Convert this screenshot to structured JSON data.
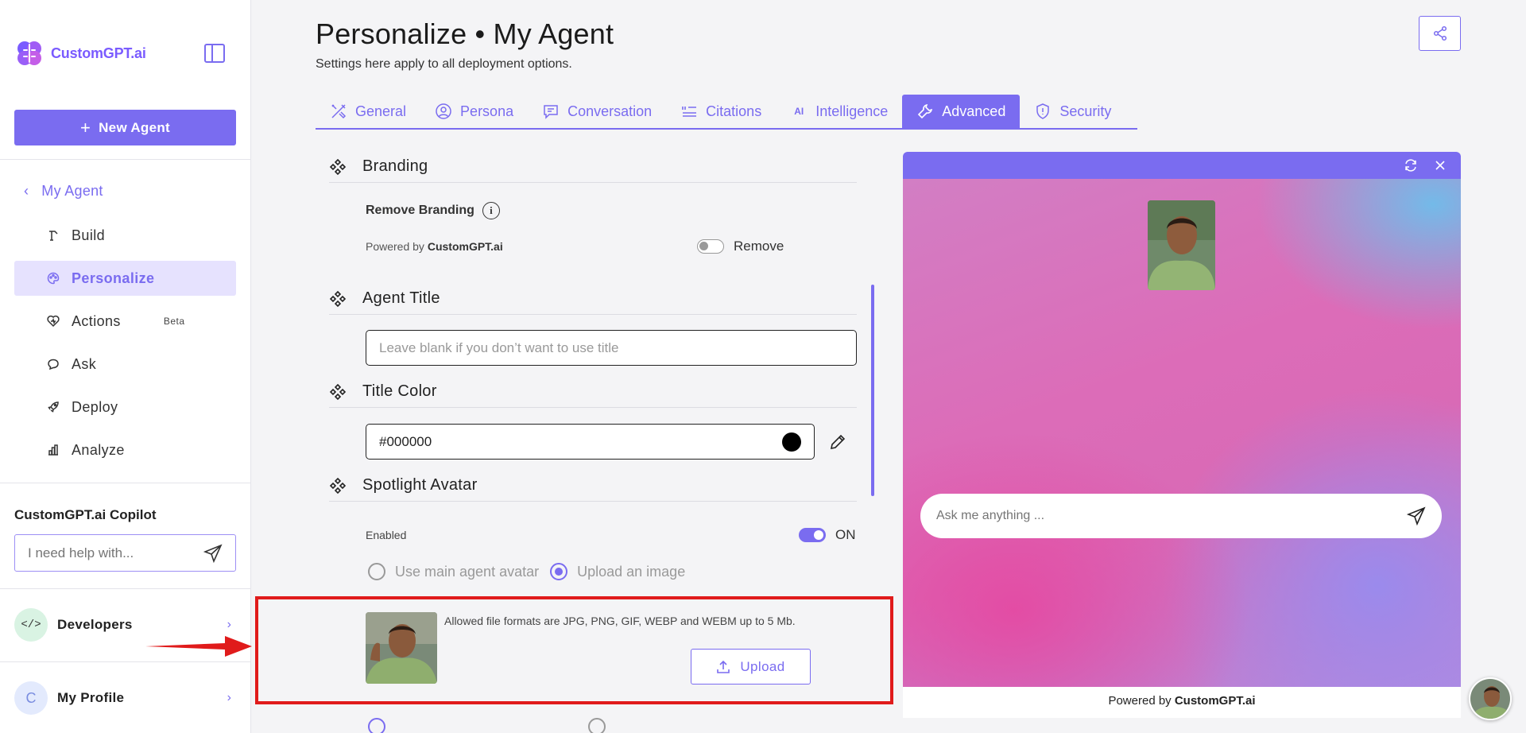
{
  "brand": {
    "name": "CustomGPT.ai",
    "accent": "#7a6cf0"
  },
  "sidebar": {
    "new_agent_label": "New Agent",
    "back_label": "My Agent",
    "items": [
      {
        "label": "Build",
        "icon": "build-icon"
      },
      {
        "label": "Personalize",
        "icon": "palette-icon",
        "active": true
      },
      {
        "label": "Actions",
        "icon": "actions-icon",
        "badge": "Beta"
      },
      {
        "label": "Ask",
        "icon": "chat-icon"
      },
      {
        "label": "Deploy",
        "icon": "rocket-icon"
      },
      {
        "label": "Analyze",
        "icon": "bar-chart-icon"
      }
    ],
    "copilot_label": "CustomGPT.ai Copilot",
    "copilot_placeholder": "I need help with...",
    "developers_label": "Developers",
    "profile_initial": "C",
    "profile_label": "My Profile"
  },
  "header": {
    "title": "Personalize • My Agent",
    "subtitle": "Settings here apply to all deployment options."
  },
  "tabs": [
    {
      "label": "General"
    },
    {
      "label": "Persona"
    },
    {
      "label": "Conversation"
    },
    {
      "label": "Citations"
    },
    {
      "label": "Intelligence"
    },
    {
      "label": "Advanced",
      "active": true
    },
    {
      "label": "Security"
    }
  ],
  "settings": {
    "branding": {
      "heading": "Branding",
      "remove_label": "Remove Branding",
      "powered_prefix": "Powered by",
      "powered_brand": "CustomGPT.ai",
      "toggle_label": "Remove",
      "toggle_on": false
    },
    "agent_title": {
      "heading": "Agent Title",
      "placeholder": "Leave blank if you don’t want to use title",
      "value": ""
    },
    "title_color": {
      "heading": "Title Color",
      "value": "#000000",
      "swatch": "#000000"
    },
    "spotlight_avatar": {
      "heading": "Spotlight Avatar",
      "enabled_label": "Enabled",
      "toggle_label": "ON",
      "toggle_on": true,
      "options": [
        {
          "label": "Use main agent avatar",
          "checked": false
        },
        {
          "label": "Upload an image",
          "checked": true
        }
      ],
      "file_note": "Allowed file formats are JPG, PNG, GIF, WEBP and WEBM up to 5 Mb.",
      "upload_label": "Upload"
    }
  },
  "preview": {
    "chat_placeholder": "Ask me anything ...",
    "powered_prefix": "Powered by",
    "powered_brand": "CustomGPT.ai"
  },
  "annotation": {
    "highlight_color": "#e01b1b"
  }
}
